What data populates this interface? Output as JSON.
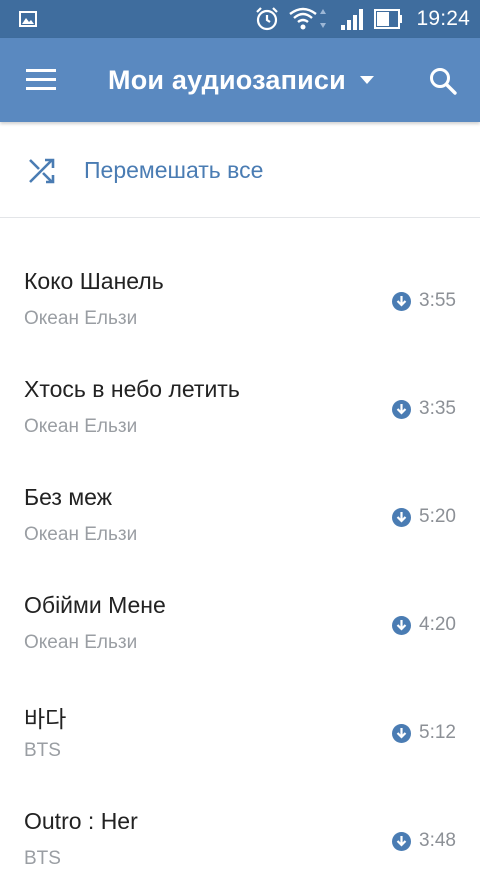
{
  "status_bar": {
    "time": "19:24",
    "icons": [
      "image-icon",
      "alarm-icon",
      "wifi-icon",
      "signal-icon",
      "battery-icon"
    ]
  },
  "app_bar": {
    "title": "Мои аудиозаписи",
    "icons": [
      "menu-icon",
      "dropdown-icon",
      "search-icon"
    ]
  },
  "shuffle": {
    "label": "Перемешать все",
    "icon": "shuffle-icon"
  },
  "tracks": [
    {
      "title": "Коко Шанель",
      "artist": "Океан Ельзи",
      "duration": "3:55"
    },
    {
      "title": "Хтось в небо летить",
      "artist": "Океан Ельзи",
      "duration": "3:35"
    },
    {
      "title": "Без меж",
      "artist": "Океан Ельзи",
      "duration": "5:20"
    },
    {
      "title": "Обійми Мене",
      "artist": "Океан Ельзи",
      "duration": "4:20"
    },
    {
      "title": "바다",
      "artist": "BTS",
      "duration": "5:12"
    },
    {
      "title": "Outro : Her",
      "artist": "BTS",
      "duration": "3:48"
    }
  ],
  "colors": {
    "status_bar": "#3f6d9e",
    "app_bar": "#5a89c0",
    "accent": "#4a7cb3"
  }
}
